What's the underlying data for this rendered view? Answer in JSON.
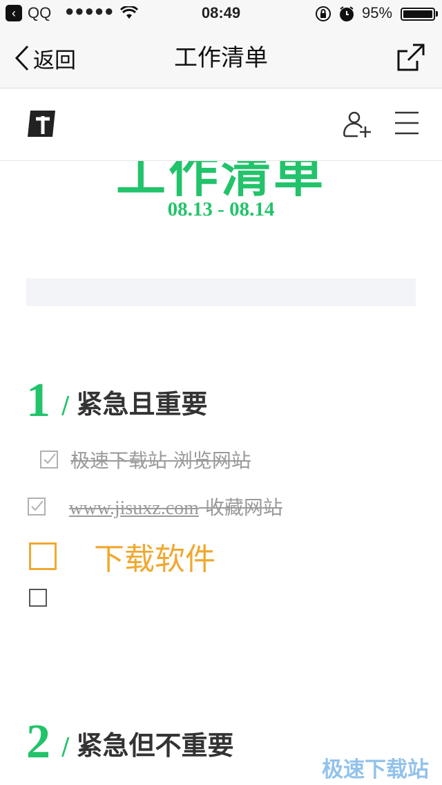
{
  "status": {
    "app": "QQ",
    "signal": "●●●●●",
    "time": "08:49",
    "battery": "95%"
  },
  "nav": {
    "back_label": "返回",
    "title": "工作清单"
  },
  "doc": {
    "big_title": "工作清单",
    "date_range": "08.13 - 08.14"
  },
  "sections": [
    {
      "number": "1",
      "slash": "/",
      "title": "紧急且重要",
      "tasks": [
        {
          "text": "极速下载站 浏览网站",
          "done": true
        },
        {
          "url": " www.jisuxz.com",
          "text": " 收藏网站",
          "done": true
        },
        {
          "text": "下载软件",
          "done": false,
          "highlight_color": "#f0a830"
        },
        {
          "text": "",
          "done": false
        }
      ]
    },
    {
      "number": "2",
      "slash": "/",
      "title": "紧急但不重要"
    }
  ],
  "watermark": "极速下载站",
  "colors": {
    "accent": "#22c36a",
    "done_text": "#9a9a9a",
    "highlight": "#f0a830"
  }
}
